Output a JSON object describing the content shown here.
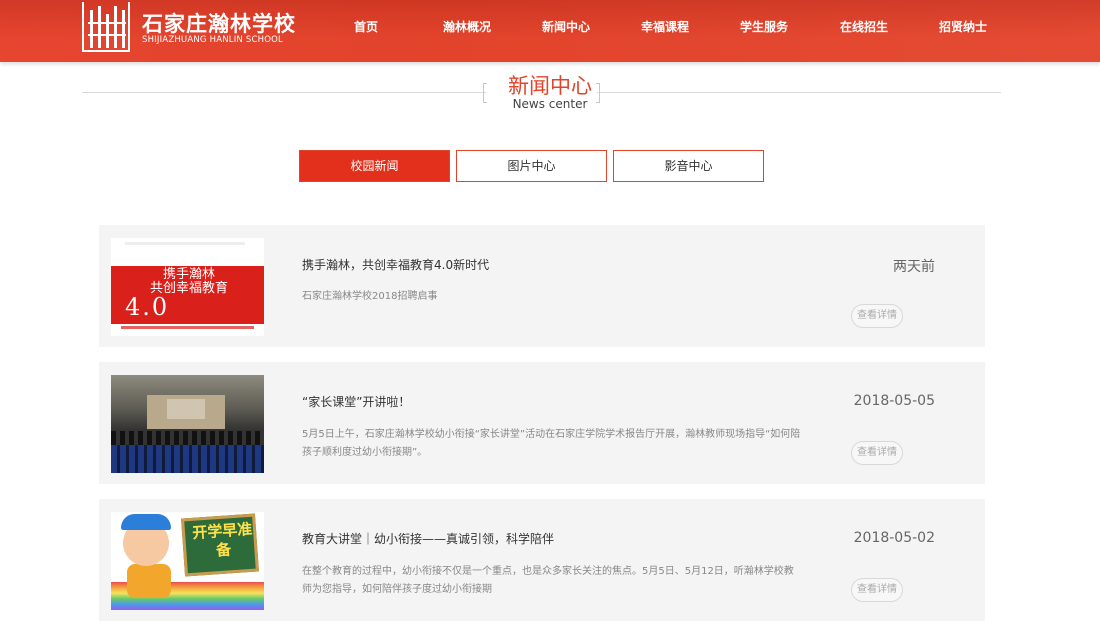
{
  "colors": {
    "brand": "#e2432b",
    "tab_active": "#e2301c",
    "card_bg": "#f4f4f4"
  },
  "header": {
    "logo_cn": "石家庄瀚林学校",
    "logo_en": "SHIJIAZHUANG HANLIN SCHOOL",
    "nav": [
      "首页",
      "瀚林概况",
      "新闻中心",
      "幸福课程",
      "学生服务",
      "在线招生",
      "招贤纳士"
    ]
  },
  "section": {
    "title_cn": "新闻中心",
    "title_en": "News center"
  },
  "tabs": [
    {
      "label": "校园新闻",
      "active": true
    },
    {
      "label": "图片中心",
      "active": false
    },
    {
      "label": "影音中心",
      "active": false
    }
  ],
  "news": [
    {
      "title": "携手瀚林，共创幸福教育4.0新时代",
      "summary": "石家庄瀚林学校2018招聘启事",
      "date": "两天前",
      "button": "查看详情",
      "thumb": {
        "line1": "携手瀚林",
        "line2": "共创幸福教育",
        "big": "4.0"
      }
    },
    {
      "title": "“家长课堂”开讲啦！",
      "summary": "5月5日上午，石家庄瀚林学校幼小衔接“家长讲堂”活动在石家庄学院学术报告厅开展，瀚林教师现场指导“如何陪孩子顺利度过幼小衔接期”。",
      "date": "2018-05-05",
      "button": "查看详情"
    },
    {
      "title": "教育大讲堂｜幼小衔接——真诚引领，科学陪伴",
      "summary": "在整个教育的过程中，幼小衔接不仅是一个重点，也是众多家长关注的焦点。5月5日、5月12日，听瀚林学校教师为您指导，如何陪伴孩子度过幼小衔接期",
      "date": "2018-05-02",
      "button": "查看详情",
      "thumb": {
        "board": "开学早准备"
      }
    }
  ]
}
